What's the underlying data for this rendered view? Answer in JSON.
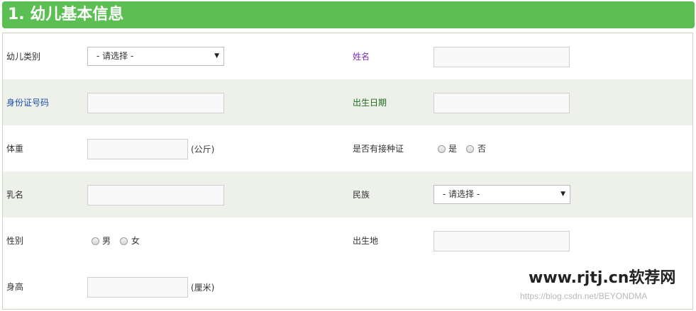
{
  "header": {
    "title": "1. 幼儿基本信息"
  },
  "fields": {
    "category": {
      "label": "幼儿类别",
      "value": "- 请选择 -"
    },
    "name": {
      "label": "姓名",
      "value": ""
    },
    "id_number": {
      "label": "身份证号码",
      "value": ""
    },
    "birth_date": {
      "label": "出生日期",
      "value": ""
    },
    "weight": {
      "label": "体重",
      "value": "",
      "unit": "(公斤)"
    },
    "vaccination": {
      "label": "是否有接种证",
      "options": [
        "是",
        "否"
      ]
    },
    "nickname": {
      "label": "乳名",
      "value": ""
    },
    "ethnicity": {
      "label": "民族",
      "value": "- 请选择 -"
    },
    "gender": {
      "label": "性别",
      "options": [
        "男",
        "女"
      ]
    },
    "birthplace": {
      "label": "出生地",
      "value": ""
    },
    "height": {
      "label": "身高",
      "value": "",
      "unit": "(厘米)"
    }
  },
  "watermark": {
    "logo": "www.rjtj.cn软荐网",
    "credit": "https://blog.csdn.net/BEYONDMA"
  },
  "colors": {
    "header_bg": "#5cbf53",
    "alt_row_bg": "#eef1e9",
    "name_label": "#7b2fb5",
    "id_label": "#1b4fa8",
    "birth_label": "#1d6b1d"
  }
}
